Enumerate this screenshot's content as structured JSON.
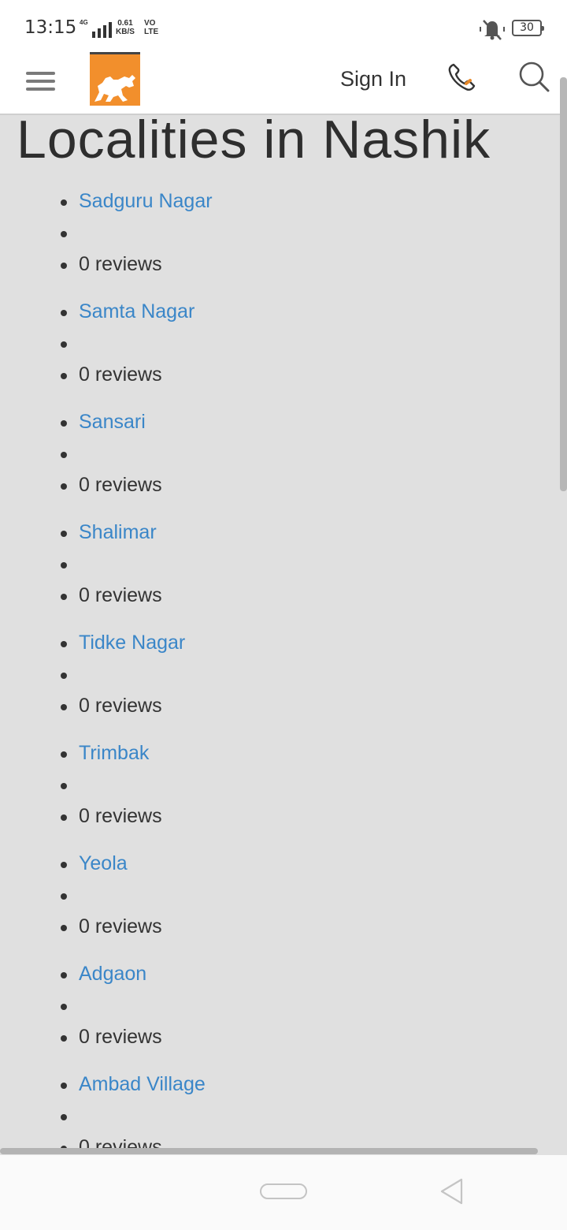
{
  "status_bar": {
    "time": "13:15",
    "network": "4G",
    "speed_value": "0.61",
    "speed_unit": "KB/S",
    "volte_top": "VO",
    "volte_bottom": "LTE",
    "battery": "30"
  },
  "header": {
    "sign_in_label": "Sign In",
    "logo_color": "#f28f2c"
  },
  "page": {
    "title": "Localities in Nashik"
  },
  "localities": [
    {
      "name": "Sadguru Nagar",
      "reviews": "0 reviews"
    },
    {
      "name": "Samta Nagar",
      "reviews": "0 reviews"
    },
    {
      "name": "Sansari",
      "reviews": "0 reviews"
    },
    {
      "name": "Shalimar",
      "reviews": "0 reviews"
    },
    {
      "name": "Tidke Nagar",
      "reviews": "0 reviews"
    },
    {
      "name": "Trimbak",
      "reviews": "0 reviews"
    },
    {
      "name": "Yeola",
      "reviews": "0 reviews"
    },
    {
      "name": "Adgaon",
      "reviews": "0 reviews"
    },
    {
      "name": "Ambad Village",
      "reviews": "0 reviews"
    }
  ],
  "colors": {
    "link": "#3a86c8",
    "background": "#e0e0e0",
    "brand": "#f28f2c"
  },
  "icons": {
    "menu": "hamburger-icon",
    "phone": "phone-icon",
    "search": "search-icon",
    "mute": "mute-icon",
    "home": "home-pill-icon",
    "back": "back-triangle-icon"
  }
}
